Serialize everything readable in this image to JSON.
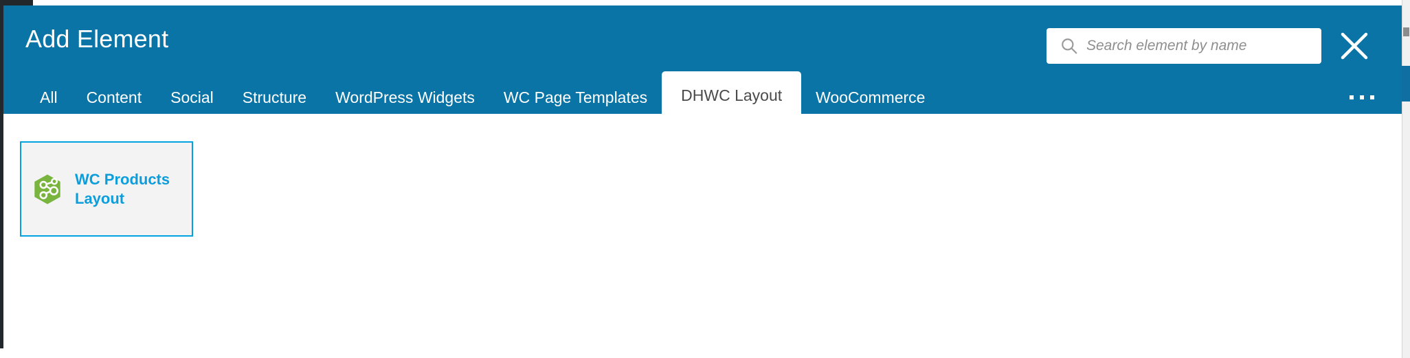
{
  "window": {
    "accent_blue": "#0a74a6",
    "card_border": "#00a3e0",
    "card_label_color": "#0d9ddb",
    "icon_green": "#79b43f"
  },
  "header": {
    "title": "Add Element",
    "search": {
      "placeholder": "Search element by name",
      "value": "",
      "icon": "search-icon"
    },
    "close": {
      "icon": "close-icon",
      "label": "Close"
    }
  },
  "tabs": {
    "items": [
      {
        "label": "All",
        "active": false
      },
      {
        "label": "Content",
        "active": false
      },
      {
        "label": "Social",
        "active": false
      },
      {
        "label": "Structure",
        "active": false
      },
      {
        "label": "WordPress Widgets",
        "active": false
      },
      {
        "label": "WC Page Templates",
        "active": false
      },
      {
        "label": "DHWC Layout",
        "active": true
      },
      {
        "label": "WooCommerce",
        "active": false
      }
    ],
    "overflow": {
      "label": "...",
      "icon": "ellipsis-icon"
    }
  },
  "body": {
    "elements": [
      {
        "label": "WC Products Layout",
        "icon": "wc-products-layout-icon",
        "selected": true
      }
    ]
  }
}
